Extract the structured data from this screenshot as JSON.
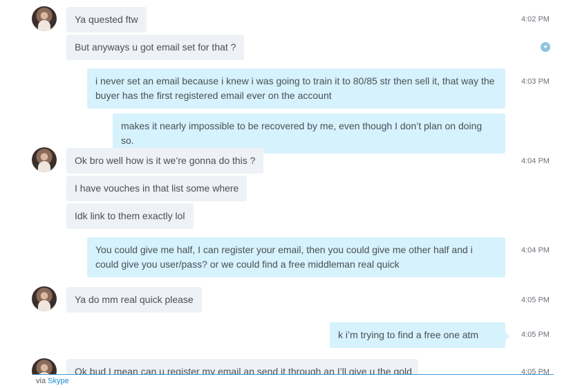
{
  "messages": [
    {
      "from": "them",
      "text": "Ya quested ftw",
      "time": "4:02 PM"
    },
    {
      "from": "them",
      "text": "But anyways u got email set for that ?",
      "time": ""
    },
    {
      "from": "me",
      "text": "i never set an email because i knew i was going to train it to 80/85 str then sell it, that way the buyer has the first registered email ever on the account",
      "time": "4:03 PM"
    },
    {
      "from": "me",
      "text": "makes it nearly impossible to be recovered by me, even though I don’t plan on doing so.",
      "time": ""
    },
    {
      "from": "them",
      "text": "Ok bro well how is it we’re gonna do this ?",
      "time": "4:04 PM"
    },
    {
      "from": "them",
      "text": "I have vouches in that list some where",
      "time": ""
    },
    {
      "from": "them",
      "text": "Idk link to them exactly lol",
      "time": ""
    },
    {
      "from": "me",
      "text": "You could give me half, I can register your email, then you could give me other half and i could give you user/pass? or we could find a free middleman real quick",
      "time": "4:04 PM"
    },
    {
      "from": "them",
      "text": "Ya do mm real quick please",
      "time": "4:05 PM"
    },
    {
      "from": "me",
      "text": "k i’m trying to find a free one atm",
      "time": "4:05 PM"
    },
    {
      "from": "them",
      "text": "Ok bud I mean can u register my email an send it through an I’ll give u the gold",
      "time": "4:05 PM"
    }
  ],
  "footer": {
    "via_label": "via",
    "app_link": "Skype"
  },
  "icons": {
    "avatar": "contact-avatar",
    "status": "chevron-down-circle-icon"
  },
  "colors": {
    "incoming_bubble": "#eef2f6",
    "outgoing_bubble": "#d6f2fc",
    "link": "#1a8ad4",
    "accent_line": "#3a9bd9"
  }
}
